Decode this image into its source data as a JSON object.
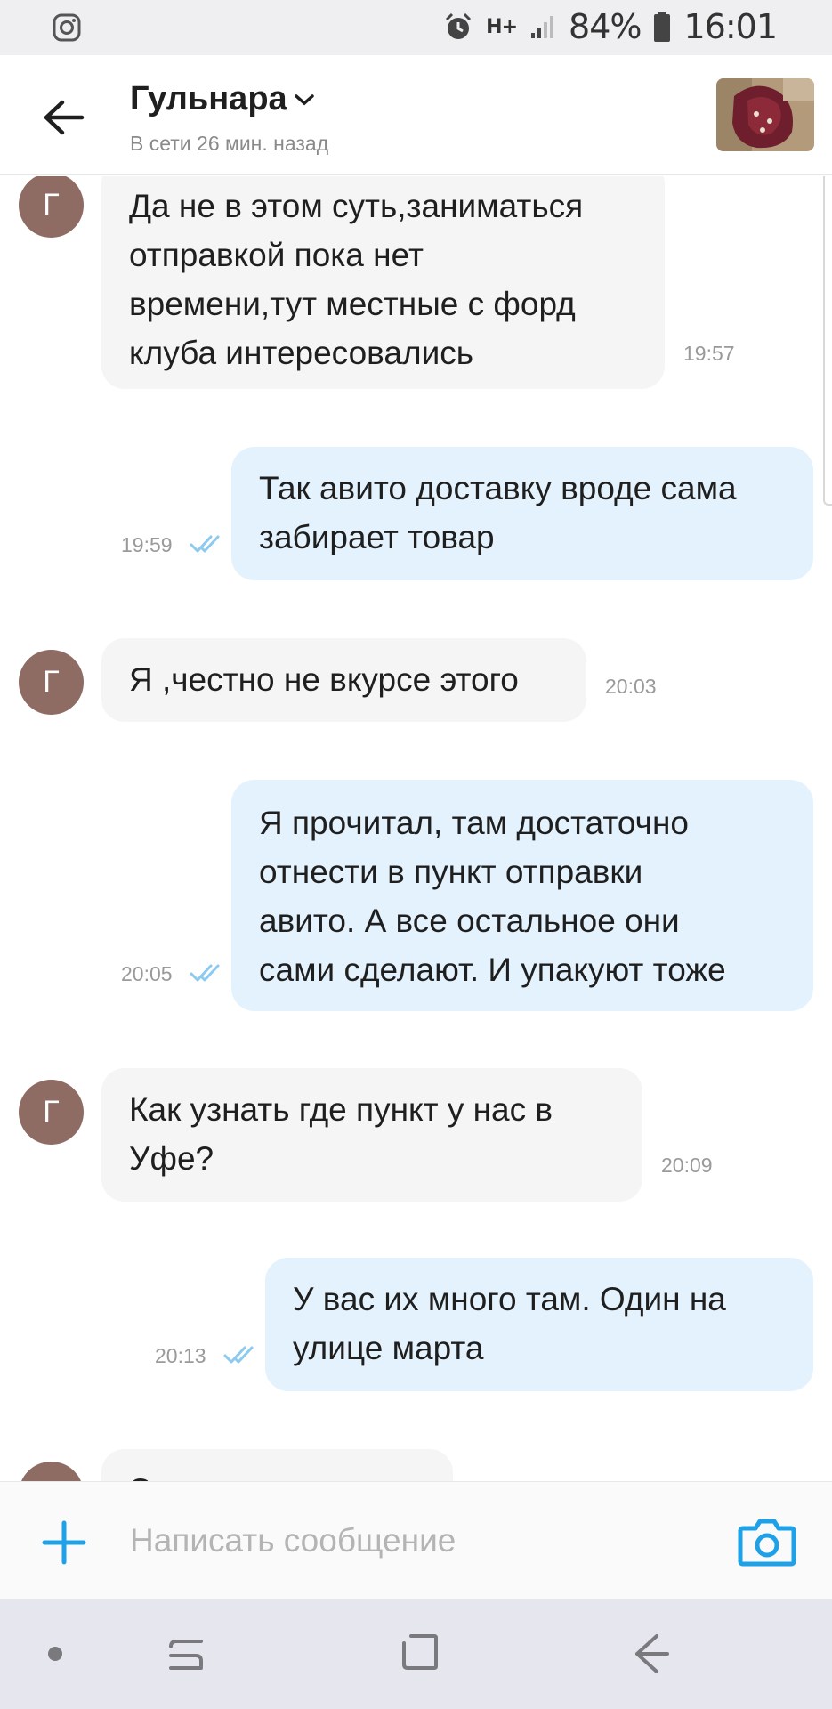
{
  "status_bar": {
    "battery": "84%",
    "time": "16:01",
    "network": "H+"
  },
  "header": {
    "contact_name": "Гульнара",
    "contact_status": "В сети 26 мин. назад"
  },
  "messages": [
    {
      "dir": "in",
      "avatar": "Г",
      "text": "Да не в этом суть,заниматься\nотправкой пока нет\nвремени,тут местные с форд\nклуба интересовались",
      "time": "19:57"
    },
    {
      "dir": "out",
      "text": "Так авито доставку вроде сама\nзабирает товар",
      "time": "19:59",
      "status": "read"
    },
    {
      "dir": "in",
      "avatar": "Г",
      "text": "Я ,честно не вкурсе этого",
      "time": "20:03"
    },
    {
      "dir": "out",
      "text": "Я прочитал, там достаточно\nотнести в пункт отправки\nавито. А все остальное они\nсами сделают. И упакуют тоже",
      "time": "20:05",
      "status": "read"
    },
    {
      "dir": "in",
      "avatar": "Г",
      "text": "Как узнать где пункт у нас в\nУфе?",
      "time": "20:09"
    },
    {
      "dir": "out",
      "text": "У вас их много там. Один на\nулице марта",
      "time": "20:13",
      "status": "read"
    },
    {
      "dir": "in",
      "avatar": "Г",
      "text": "Э",
      "time": ""
    }
  ],
  "composer": {
    "placeholder": "Написать сообщение",
    "value": ""
  },
  "icons": {
    "status_left": "instagram-icon",
    "alarm": "alarm-icon",
    "signal": "signal-icon",
    "battery": "battery-icon",
    "back": "arrow-left-icon",
    "dropdown": "chevron-down-icon",
    "read_receipt": "double-check-icon",
    "attach": "plus-icon",
    "camera": "camera-icon",
    "nav_dot": "dot-icon",
    "nav_recents": "recents-icon",
    "nav_home": "home-icon",
    "nav_back": "back-arrow-icon"
  },
  "colors": {
    "accent": "#1ea1e6",
    "outgoing_bubble": "#e3f2fc",
    "incoming_bubble": "#f5f5f5",
    "avatar": "#8e6b63",
    "read_check": "#8ccaf0"
  }
}
